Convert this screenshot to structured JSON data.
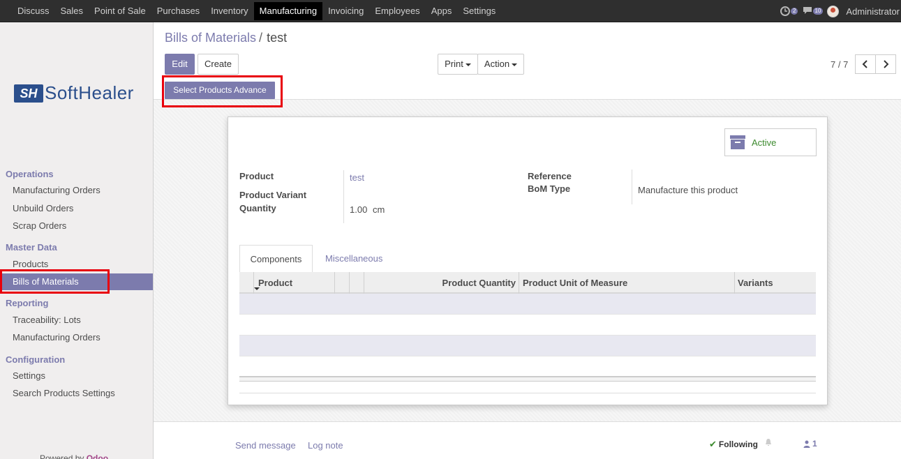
{
  "topnav": [
    "Discuss",
    "Sales",
    "Point of Sale",
    "Purchases",
    "Inventory",
    "Manufacturing",
    "Invoicing",
    "Employees",
    "Apps",
    "Settings"
  ],
  "topbar": {
    "activity_count": "2",
    "messages_count": "10",
    "user_name": "Administrator"
  },
  "logo": {
    "mark": "SH",
    "text": "SoftHealer"
  },
  "sidebar": {
    "sections": [
      {
        "title": "Operations",
        "items": [
          "Manufacturing Orders",
          "Unbuild Orders",
          "Scrap Orders"
        ]
      },
      {
        "title": "Master Data",
        "items": [
          "Products",
          "Bills of Materials"
        ]
      },
      {
        "title": "Reporting",
        "items": [
          "Traceability: Lots",
          "Manufacturing Orders"
        ]
      },
      {
        "title": "Configuration",
        "items": [
          "Settings",
          "Search Products Settings"
        ]
      }
    ],
    "selected": "Bills of Materials",
    "powered_by": "Powered by",
    "powered_brand": "Odoo"
  },
  "breadcrumb": {
    "parent": "Bills of Materials",
    "separator": "/",
    "current": "test"
  },
  "buttons": {
    "edit": "Edit",
    "create": "Create",
    "print": "Print",
    "action": "Action",
    "select_products_advance": "Select Products Advance"
  },
  "pager": {
    "value": "7 / 7"
  },
  "form": {
    "active_label": "Active",
    "product_label": "Product",
    "product_value": "test",
    "variant_label": "Product Variant",
    "quantity_label": "Quantity",
    "quantity_value": "1.00",
    "quantity_uom": "cm",
    "reference_label": "Reference",
    "bom_type_label": "BoM Type",
    "bom_type_value": "Manufacture this product"
  },
  "tabs": [
    "Components",
    "Miscellaneous"
  ],
  "table": {
    "columns": [
      "Product",
      "Product Quantity",
      "Product Unit of Measure",
      "Variants"
    ]
  },
  "chatter": {
    "send_message": "Send message",
    "log_note": "Log note",
    "following": "Following",
    "followers": "1"
  },
  "colors": {
    "brand": "#7c7bad",
    "topbar": "#2f2f2f",
    "highlight": "#e8000c",
    "active_green": "#3c8a2e"
  }
}
